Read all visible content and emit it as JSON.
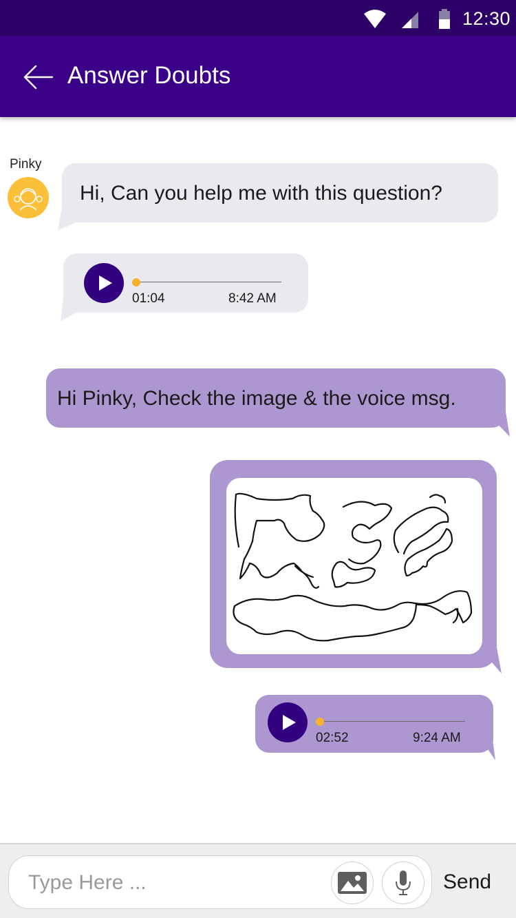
{
  "status_bar": {
    "time": "12:30",
    "icons": [
      "wifi-icon",
      "signal-icon",
      "battery-icon"
    ],
    "color": "#2d0068"
  },
  "app_bar": {
    "title": "Answer Doubts",
    "back_icon": "arrow-left-icon",
    "color": "#3a0088"
  },
  "chat": {
    "messages": [
      {
        "from": "incoming",
        "sender": "Pinky",
        "type": "text",
        "text": "Hi, Can you help me with this question?"
      },
      {
        "from": "incoming",
        "type": "audio",
        "duration": "01:04",
        "time": "8:42 AM",
        "progress": 0
      },
      {
        "from": "outgoing",
        "type": "text",
        "text": "Hi Pinky, Check the image & the voice msg."
      },
      {
        "from": "outgoing",
        "type": "image",
        "content": "hand-drawn sketch"
      },
      {
        "from": "outgoing",
        "type": "audio",
        "duration": "02:52",
        "time": "9:24 AM",
        "progress": 0
      }
    ]
  },
  "composer": {
    "placeholder": "Type Here ...",
    "value": "",
    "image_button_icon": "image-icon",
    "mic_button_icon": "microphone-icon",
    "send_label": "Send"
  },
  "colors": {
    "incoming_bubble": "#e8eaf0",
    "outgoing_bubble": "#ac97d1",
    "play_button": "#330080",
    "progress_knob": "#f7b12b",
    "avatar": "#fbbf3a"
  }
}
